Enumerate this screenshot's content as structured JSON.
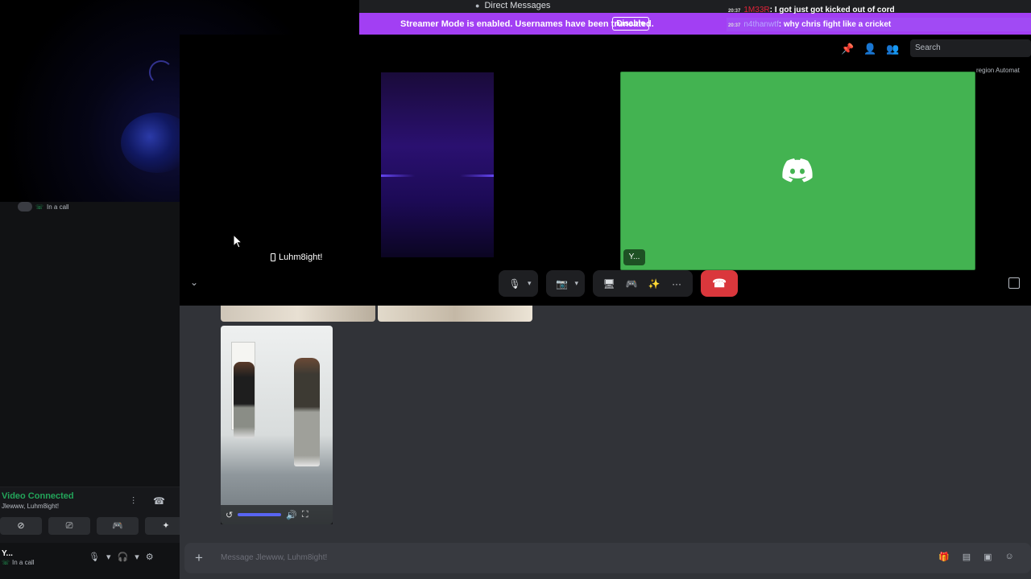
{
  "window": {
    "title": "Direct Messages"
  },
  "banner": {
    "text": "Streamer Mode is enabled. Usernames have been truncated.",
    "button": "Disable",
    "color": "#a23ff3"
  },
  "stream_chat": [
    {
      "time": "20:37",
      "user": "1M33R",
      "message": ": I got just got kicked out of cord",
      "user_color": "#e0243a"
    },
    {
      "time": "20:37",
      "user": "n4thanwtf",
      "message": ": why chris fight like a cricket",
      "user_color": "#b8a6ff"
    }
  ],
  "header": {
    "icons": [
      "pin-icon",
      "add-friend-icon",
      "members-icon"
    ],
    "search_placeholder": "Search",
    "side_labels": "region    Automat"
  },
  "call": {
    "participant_label": "Luhm8ight!",
    "green_tile_label": "Y...",
    "green_tile_color": "#43b351",
    "controls": {
      "mic": "🎙",
      "camera": "📷",
      "screen": "🖥",
      "activity": "🎮",
      "soundboard": "✨",
      "more": "···",
      "leave": "☎"
    }
  },
  "sidebar": {
    "call_status": "In a call",
    "voice_status": "Video Connected",
    "voice_channel": "Jlewww, Luhm8ight!",
    "user_name": "Y...",
    "user_status": "In a call"
  },
  "message_input": {
    "placeholder": "Message Jlewww, Luhm8ight!"
  },
  "accent": "#5865f2",
  "danger": "#da373c",
  "video_progress": 0.6
}
